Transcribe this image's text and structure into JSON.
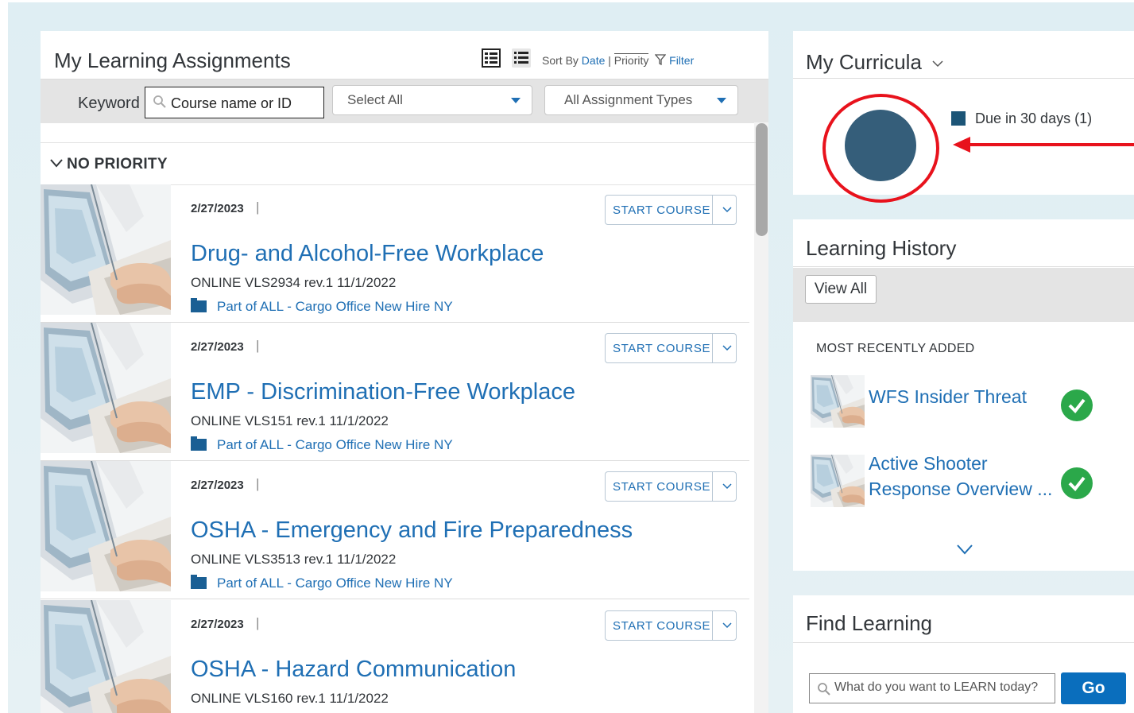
{
  "assignments": {
    "title": "My Learning Assignments",
    "sort_by_label": "Sort By",
    "sort_date": "Date",
    "sort_separator": "|",
    "sort_priority": "Priority",
    "filter_label": "Filter",
    "keyword_label": "Keyword",
    "keyword_placeholder": "Course name or ID",
    "select_all": "Select All",
    "assignment_types": "All Assignment Types",
    "group_label": "NO PRIORITY",
    "start_label": "START COURSE",
    "courses": [
      {
        "date": "2/27/2023",
        "title": "Drug- and Alcohol-Free Workplace",
        "meta": "ONLINE VLS2934 rev.1 11/1/2022",
        "part_of": "Part of ALL - Cargo Office New Hire NY"
      },
      {
        "date": "2/27/2023",
        "title": "EMP - Discrimination-Free Workplace",
        "meta": "ONLINE VLS151 rev.1 11/1/2022",
        "part_of": "Part of ALL - Cargo Office New Hire NY"
      },
      {
        "date": "2/27/2023",
        "title": "OSHA - Emergency and Fire Preparedness",
        "meta": "ONLINE VLS3513 rev.1 11/1/2022",
        "part_of": "Part of ALL - Cargo Office New Hire NY"
      },
      {
        "date": "2/27/2023",
        "title": "OSHA - Hazard Communication",
        "meta": "ONLINE VLS160 rev.1 11/1/2022",
        "part_of": ""
      }
    ]
  },
  "curricula": {
    "title": "My Curricula",
    "legend": "Due in 30 days (1)",
    "donut_color": "#355e7a",
    "highlight_color": "#e8121c"
  },
  "history": {
    "title": "Learning History",
    "view_all": "View All",
    "section_label": "MOST RECENTLY ADDED",
    "items": [
      {
        "title_line1": "WFS Insider Threat",
        "title_line2": ""
      },
      {
        "title_line1": "Active Shooter",
        "title_line2": "Response Overview ..."
      }
    ]
  },
  "find": {
    "title": "Find Learning",
    "placeholder": "What do you want to LEARN today?",
    "go_label": "Go"
  },
  "colors": {
    "link": "#1f6fb4",
    "primary_button": "#0a6ebd",
    "success": "#2ba84a"
  }
}
